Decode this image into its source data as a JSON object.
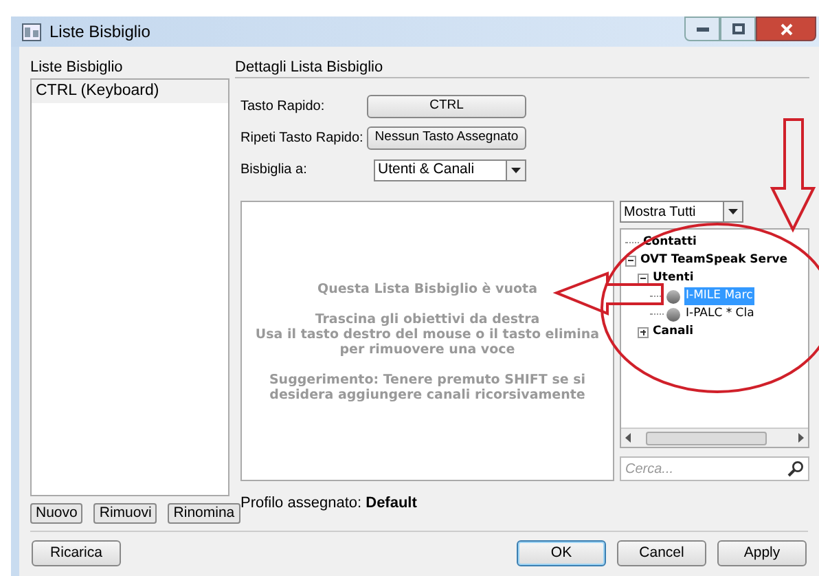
{
  "window": {
    "title": "Liste Bisbiglio"
  },
  "lists_panel": {
    "label": "Liste Bisbiglio",
    "items": [
      {
        "label": "CTRL (Keyboard)",
        "selected": false
      }
    ],
    "buttons": [
      "Nuovo",
      "Rimuovi",
      "Rinomina"
    ]
  },
  "details": {
    "label": "Dettagli Lista Bisbiglio",
    "hotkey": {
      "label": "Tasto Rapido:",
      "value": "CTRL"
    },
    "repeat_hotkey": {
      "label": "Ripeti Tasto Rapido:",
      "value": "Nessun Tasto Assegnato"
    },
    "whisper_to": {
      "label": "Bisbiglia a:",
      "value": "Utenti & Canali"
    },
    "empty_message": {
      "title": "Questa Lista Bisbiglio è vuota",
      "lines": [
        "Trascina gli obiettivi da destra\nUsa il tasto destro del mouse o il tasto elimina per rimuovere una voce",
        "Suggerimento: Tenere premuto SHIFT se si desidera aggiungere canali ricorsivamente"
      ]
    },
    "profile": {
      "text": "Profilo assegnato: **Default**"
    }
  },
  "targets": {
    "filter": "Mostra Tutti",
    "tree": [
      {
        "label": "Contatti",
        "selected": false
      },
      {
        "label": "OVT TeamSpeak Serve",
        "selected": false,
        "expanded": true,
        "children": [
          {
            "label": "Utenti",
            "selected": false,
            "expanded": true,
            "children": [
              {
                "label": "I-MILE Marc",
                "selected": true,
                "kind": "user"
              },
              {
                "label": "I-PALC * Cla",
                "selected": false,
                "kind": "user"
              }
            ]
          },
          {
            "label": "Canali",
            "selected": false,
            "expanded": false
          }
        ]
      }
    ],
    "search": {
      "placeholder": "Cerca..."
    }
  },
  "buttons": [
    {
      "label": "Ricarica",
      "default": false
    },
    {
      "label": "OK",
      "default": true
    },
    {
      "label": "Cancel",
      "default": false
    },
    {
      "label": "Apply",
      "default": false
    }
  ]
}
